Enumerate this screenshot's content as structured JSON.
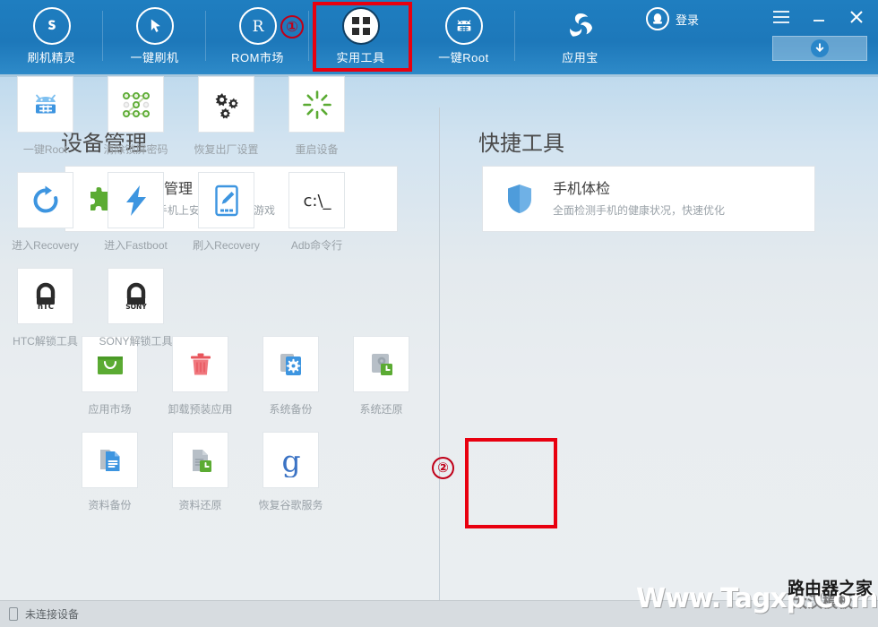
{
  "colors": {
    "header_blue": "#1d78ba",
    "highlight_red": "#e8000f",
    "annotation_red": "#c00018",
    "green": "#5bab33",
    "blue_accent": "#3d95e0"
  },
  "header": {
    "nav_items": [
      {
        "label": "刷机精灵",
        "icon": "shield-s-icon",
        "active": false
      },
      {
        "label": "一键刷机",
        "icon": "cursor-arrow-icon",
        "active": false
      },
      {
        "label": "ROM市场",
        "icon": "registered-r-icon",
        "active": false
      },
      {
        "label": "实用工具",
        "icon": "grid-squares-icon",
        "active": true
      },
      {
        "label": "一键Root",
        "icon": "android-root-icon",
        "active": false
      },
      {
        "label": "应用宝",
        "icon": "tencent-appbao-icon",
        "active": false
      }
    ],
    "login_label": "登录",
    "login_icon": "penguin-avatar-icon",
    "menu_icon": "hamburger-menu-icon",
    "minimize_icon": "minimize-icon",
    "close_icon": "close-icon",
    "download_icon": "download-arrow-icon"
  },
  "annotations": {
    "step1": "①",
    "step2": "②"
  },
  "left_column": {
    "title": "设备管理",
    "feature": {
      "icon": "puzzle-piece-icon",
      "title": "应用管理",
      "subtitle": "管理手机上安装的应用及游戏"
    },
    "tiles": [
      [
        {
          "label": "应用市场",
          "icon": "shopping-bag-icon"
        },
        {
          "label": "卸载预装应用",
          "icon": "trash-can-icon"
        },
        {
          "label": "系统备份",
          "icon": "system-backup-icon"
        },
        {
          "label": "系统还原",
          "icon": "system-restore-icon"
        }
      ],
      [
        {
          "label": "资料备份",
          "icon": "data-backup-icon"
        },
        {
          "label": "资料还原",
          "icon": "data-restore-icon"
        },
        {
          "label": "恢复谷歌服务",
          "icon": "google-g-icon"
        }
      ]
    ]
  },
  "right_column": {
    "title": "快捷工具",
    "feature": {
      "icon": "shield-check-icon",
      "title": "手机体检",
      "subtitle": "全面检测手机的健康状况，快速优化"
    },
    "tiles": [
      [
        {
          "label": "一键Root",
          "icon": "android-root-icon"
        },
        {
          "label": "清除锁屏密码",
          "icon": "pattern-lock-icon"
        },
        {
          "label": "恢复出厂设置",
          "icon": "gears-icon"
        },
        {
          "label": "重启设备",
          "icon": "restart-burst-icon"
        }
      ],
      [
        {
          "label": "进入Recovery",
          "icon": "refresh-circle-icon",
          "highlighted": true
        },
        {
          "label": "进入Fastboot",
          "icon": "lightning-bolt-icon"
        },
        {
          "label": "刷入Recovery",
          "icon": "phone-pencil-icon"
        },
        {
          "label": "Adb命令行",
          "icon": "command-prompt-icon"
        }
      ],
      [
        {
          "label": "HTC解锁工具",
          "icon": "htc-unlock-icon"
        },
        {
          "label": "SONY解锁工具",
          "icon": "sony-unlock-icon"
        }
      ]
    ]
  },
  "footer": {
    "status_icon": "phone-outline-icon",
    "status_text": "未连接设备"
  },
  "watermark": {
    "main": "Www.Tagxp.Com",
    "cn": "路由器之家",
    "cn2": "太汉模板"
  }
}
